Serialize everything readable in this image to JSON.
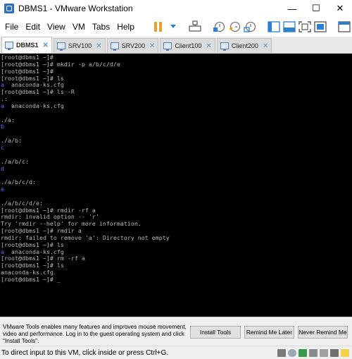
{
  "window": {
    "title": "DBMS1 - VMware Workstation",
    "minimize_glyph": "—",
    "maximize_glyph": "☐",
    "close_glyph": "✕"
  },
  "menu": {
    "items": [
      "File",
      "Edit",
      "View",
      "VM",
      "Tabs",
      "Help"
    ]
  },
  "tabs": [
    {
      "label": "DBMS1",
      "active": true
    },
    {
      "label": "SRV100",
      "active": false
    },
    {
      "label": "SRV200",
      "active": false
    },
    {
      "label": "Client100",
      "active": false
    },
    {
      "label": "Client200",
      "active": false
    }
  ],
  "tab_close_glyph": "✕",
  "terminal": {
    "lines": [
      [
        {
          "t": "[root@dbms1 ~]#",
          "c": "n"
        }
      ],
      [
        {
          "t": "[root@dbms1 ~]# mkdir -p a/b/c/d/e",
          "c": "n"
        }
      ],
      [
        {
          "t": "[root@dbms1 ~]#",
          "c": "n"
        }
      ],
      [
        {
          "t": "[root@dbms1 ~]# ls",
          "c": "n"
        }
      ],
      [
        {
          "t": "a",
          "c": "d"
        },
        {
          "t": "  anaconda-ks.cfg",
          "c": "n"
        }
      ],
      [
        {
          "t": "[root@dbms1 ~]# ls -R",
          "c": "n"
        }
      ],
      [
        {
          "t": ".:",
          "c": "n"
        }
      ],
      [
        {
          "t": "a",
          "c": "d"
        },
        {
          "t": "  anaconda-ks.cfg",
          "c": "n"
        }
      ],
      [
        {
          "t": "",
          "c": "n"
        }
      ],
      [
        {
          "t": "./a:",
          "c": "n"
        }
      ],
      [
        {
          "t": "b",
          "c": "d"
        }
      ],
      [
        {
          "t": "",
          "c": "n"
        }
      ],
      [
        {
          "t": "./a/b:",
          "c": "n"
        }
      ],
      [
        {
          "t": "c",
          "c": "d"
        }
      ],
      [
        {
          "t": "",
          "c": "n"
        }
      ],
      [
        {
          "t": "./a/b/c:",
          "c": "n"
        }
      ],
      [
        {
          "t": "d",
          "c": "d"
        }
      ],
      [
        {
          "t": "",
          "c": "n"
        }
      ],
      [
        {
          "t": "./a/b/c/d:",
          "c": "n"
        }
      ],
      [
        {
          "t": "e",
          "c": "d"
        }
      ],
      [
        {
          "t": "",
          "c": "n"
        }
      ],
      [
        {
          "t": "./a/b/c/d/e:",
          "c": "n"
        }
      ],
      [
        {
          "t": "[root@dbms1 ~]# rmdir -rf a",
          "c": "n"
        }
      ],
      [
        {
          "t": "rmdir: invalid option -- 'r'",
          "c": "n"
        }
      ],
      [
        {
          "t": "Try 'rmdir --help' for more information.",
          "c": "n"
        }
      ],
      [
        {
          "t": "[root@dbms1 ~]# rmdir a",
          "c": "n"
        }
      ],
      [
        {
          "t": "rmdir: failed to remove 'a': Directory not empty",
          "c": "n"
        }
      ],
      [
        {
          "t": "[root@dbms1 ~]# ls",
          "c": "n"
        }
      ],
      [
        {
          "t": "a",
          "c": "d"
        },
        {
          "t": "  anaconda-ks.cfg",
          "c": "n"
        }
      ],
      [
        {
          "t": "[root@dbms1 ~]# rm -rf a",
          "c": "n"
        }
      ],
      [
        {
          "t": "[root@dbms1 ~]# ls",
          "c": "n"
        }
      ],
      [
        {
          "t": "anaconda-ks.cfg",
          "c": "n"
        }
      ],
      [
        {
          "t": "[root@dbms1 ~]# _",
          "c": "n"
        }
      ]
    ]
  },
  "notification": {
    "message": "VMware Tools enables many features and improves mouse movement, video and performance. Log in to the guest operating system and click \"Install Tools\".",
    "install_label": "Install Tools",
    "remind_later_label": "Remind Me Later",
    "never_remind_label": "Never Remind Me"
  },
  "status": {
    "text": "To direct input to this VM, click inside or press Ctrl+G."
  },
  "colors": {
    "terminal_bg": "#000000",
    "terminal_text": "#b8b8b8",
    "terminal_dir": "#5b6cff",
    "pause_orange": "#f0a020",
    "toolbar_icon": "#2f7fd0"
  },
  "icons": {
    "toolbar": [
      "pause-icon",
      "dropdown-icon",
      "send-keys-icon",
      "snapshot-icon",
      "revert-snapshot-icon",
      "snapshot-manager-icon",
      "library-icon",
      "console-view-icon",
      "fullscreen-icon",
      "unity-icon",
      "thumbnail-icon"
    ],
    "status": [
      "hdd-icon",
      "cdrom-icon",
      "network-icon",
      "usb-icon",
      "printer-icon",
      "sound-icon",
      "message-icon"
    ]
  }
}
